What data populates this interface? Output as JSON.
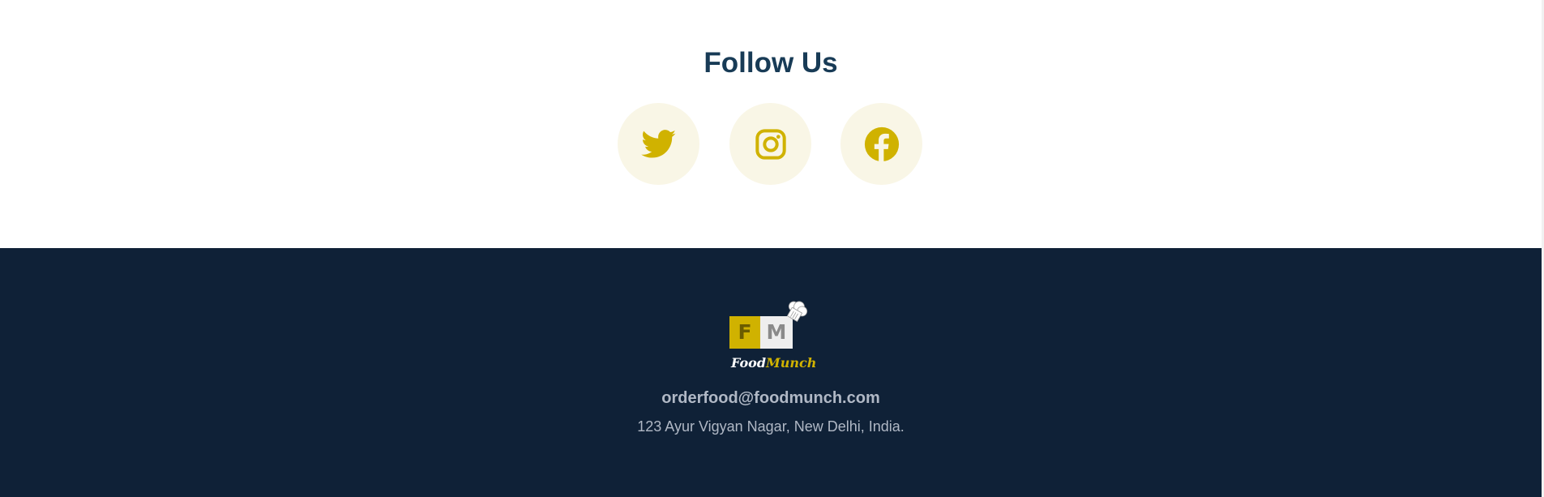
{
  "follow": {
    "title": "Follow Us",
    "social": [
      {
        "name": "twitter",
        "icon": "twitter-icon"
      },
      {
        "name": "instagram",
        "icon": "instagram-icon"
      },
      {
        "name": "facebook",
        "icon": "facebook-icon"
      }
    ]
  },
  "footer": {
    "logo": {
      "letter_f": "F",
      "letter_m": "M",
      "wordmark_part1": "Food",
      "wordmark_part2": "Munch",
      "icon": "chef-hat-icon"
    },
    "email": "orderfood@foodmunch.com",
    "address": "123 Ayur Vigyan Nagar, New Delhi, India."
  },
  "colors": {
    "heading": "#183b56",
    "accent": "#d0b200",
    "social_bg": "#f9f6e6",
    "footer_bg": "#0f2137",
    "footer_text": "#b0b8c5"
  }
}
